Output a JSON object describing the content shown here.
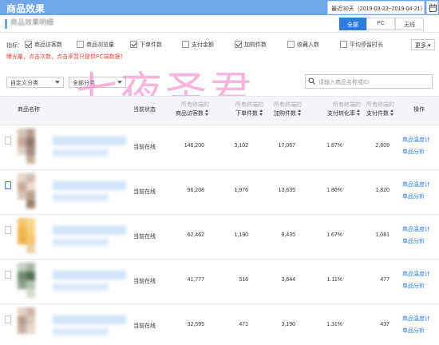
{
  "header": {
    "title": "商品效果",
    "date_range": "最近30天（2019-03-23~2019-04-21）"
  },
  "section": {
    "title": "商品效果明细",
    "segments": [
      {
        "label": "全部",
        "active": true
      },
      {
        "label": "PC",
        "active": false
      },
      {
        "label": "无线",
        "active": false
      }
    ]
  },
  "metrics": {
    "label": "指标：",
    "items": [
      {
        "label": "商品访客数",
        "checked": true
      },
      {
        "label": "商品浏览量",
        "checked": false
      },
      {
        "label": "下单件数",
        "checked": true
      },
      {
        "label": "支付金额",
        "checked": false
      },
      {
        "label": "加购件数",
        "checked": true
      },
      {
        "label": "收藏人数",
        "checked": false
      },
      {
        "label": "平均停留时长",
        "checked": false
      }
    ],
    "more_label": "更多",
    "hint": "曝光量，点击次数，点击率暂只提供PC端数据！"
  },
  "filters": {
    "category": "自定义分类",
    "class": "全部分类",
    "search_placeholder": "请输入商品名称或ID"
  },
  "watermark": "七夜圣君",
  "table": {
    "headers": {
      "name": "商品名称",
      "status": "当前状态",
      "visitors": {
        "sub": "所有终端的",
        "main": "商品访客数"
      },
      "orders": {
        "sub": "所有终端的",
        "main": "下单件数"
      },
      "cart": {
        "sub": "所有终端的",
        "main": "加购件数"
      },
      "conv": {
        "sub": "所有终端的",
        "main": "支付转化率"
      },
      "paid": {
        "sub": "所有终端的",
        "main": "支付件数"
      },
      "ops": "操作"
    },
    "rows": [
      {
        "status": "当前在线",
        "visitors": "146,200",
        "orders": "3,102",
        "cart": "17,067",
        "conv": "1.87%",
        "paid": "2,809",
        "op1": "商品温度计",
        "op2": "单品分析"
      },
      {
        "status": "当前在线",
        "visitors": "96,208",
        "orders": "1,976",
        "cart": "13,635",
        "conv": "1.86%",
        "paid": "1,820",
        "op1": "商品温度计",
        "op2": "单品分析"
      },
      {
        "status": "当前在线",
        "visitors": "62,462",
        "orders": "1,190",
        "cart": "9,435",
        "conv": "1.67%",
        "paid": "1,081",
        "op1": "商品温度计",
        "op2": "单品分析"
      },
      {
        "status": "当前在线",
        "visitors": "41,777",
        "orders": "516",
        "cart": "3,644",
        "conv": "1.11%",
        "paid": "477",
        "op1": "商品温度计",
        "op2": "单品分析"
      },
      {
        "status": "当前在线",
        "visitors": "32,595",
        "orders": "471",
        "cart": "3,190",
        "conv": "1.31%",
        "paid": "437",
        "op1": "商品温度计",
        "op2": "单品分析"
      }
    ]
  },
  "colors": {
    "accent": "#2f7dd8",
    "header_bg": "#6fa6e8",
    "hint": "#e84b3c",
    "watermark": "#f078be"
  }
}
